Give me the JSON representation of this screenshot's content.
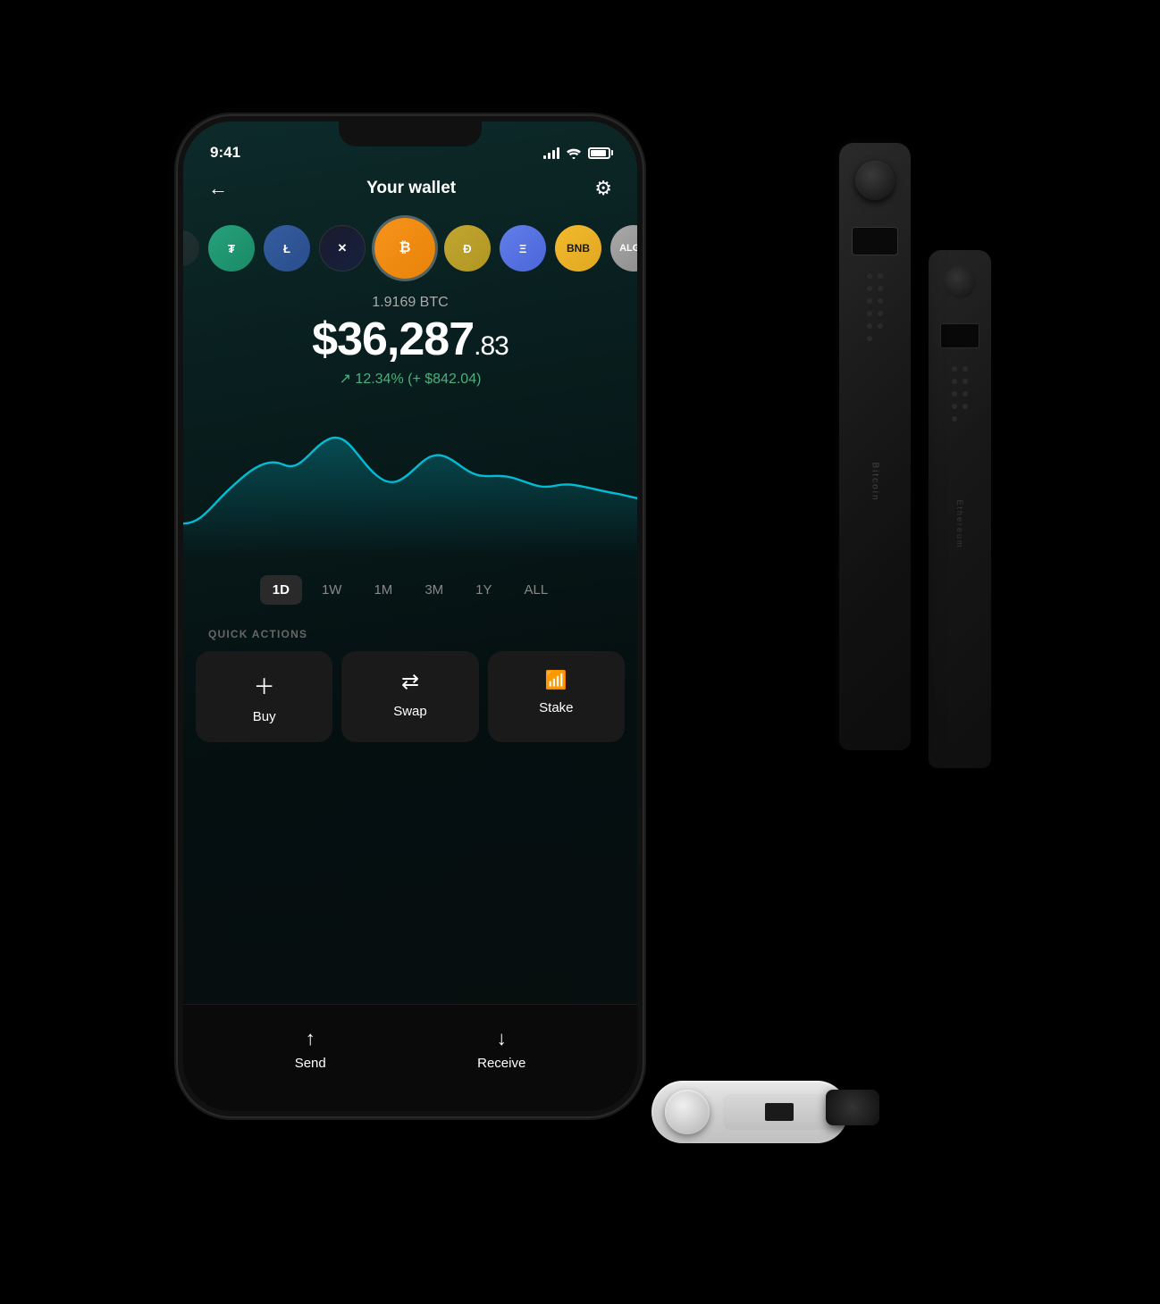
{
  "status_bar": {
    "time": "9:41"
  },
  "header": {
    "back_label": "←",
    "title": "Your wallet",
    "settings_label": "⚙"
  },
  "coins": [
    {
      "id": "partial",
      "symbol": "",
      "class": "coin-partial"
    },
    {
      "id": "tether",
      "symbol": "₮",
      "class": "coin-tether"
    },
    {
      "id": "litecoin",
      "symbol": "Ł",
      "class": "coin-litecoin"
    },
    {
      "id": "xrp",
      "symbol": "✕",
      "class": "coin-xrp"
    },
    {
      "id": "bitcoin",
      "symbol": "₿",
      "class": "coin-bitcoin",
      "active": true
    },
    {
      "id": "doge",
      "symbol": "Ð",
      "class": "coin-doge"
    },
    {
      "id": "ethereum",
      "symbol": "Ξ",
      "class": "coin-eth"
    },
    {
      "id": "bnb",
      "symbol": "B",
      "class": "coin-bnb"
    },
    {
      "id": "algo",
      "symbol": "A",
      "class": "coin-algo"
    }
  ],
  "balance": {
    "amount_crypto": "1.9169 BTC",
    "amount_usd_main": "$36,287",
    "amount_usd_cents": ".83",
    "change_percent": "↗ 12.34%",
    "change_usd": "(+ $842.04)"
  },
  "time_periods": [
    {
      "label": "1D",
      "active": true
    },
    {
      "label": "1W",
      "active": false
    },
    {
      "label": "1M",
      "active": false
    },
    {
      "label": "3M",
      "active": false
    },
    {
      "label": "1Y",
      "active": false
    },
    {
      "label": "ALL",
      "active": false
    }
  ],
  "quick_actions_label": "QUICK ACTIONS",
  "actions": [
    {
      "id": "buy",
      "icon": "+",
      "label": "Buy"
    },
    {
      "id": "swap",
      "icon": "⇄",
      "label": "Swap"
    },
    {
      "id": "stake",
      "icon": "↑↑",
      "label": "Stake"
    }
  ],
  "bottom_actions": [
    {
      "id": "send",
      "icon": "↑",
      "label": "Send"
    },
    {
      "id": "receive",
      "icon": "↓",
      "label": "Receive"
    }
  ],
  "devices": [
    {
      "id": "nano-x-black-1",
      "label": "Bitcoin"
    },
    {
      "id": "nano-x-black-2",
      "label": "Ethereum"
    },
    {
      "id": "nano-s-white",
      "label": ""
    }
  ]
}
